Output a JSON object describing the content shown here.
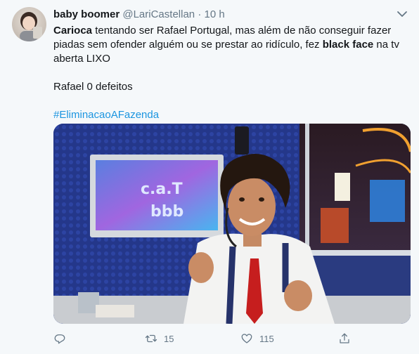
{
  "tweet": {
    "display_name": "baby boomer",
    "handle": "@LariCastellan",
    "separator": "·",
    "time": "10 h",
    "text": {
      "l1_bold": "Carioca",
      "l1_rest": " tentando ser Rafael Portugal, mas além de não conseguir fazer",
      "l2_a": "piadas sem ofender alguém ou se prestar ao ridículo, fez ",
      "l2_bold": "black face",
      "l2_b": " na tv",
      "l3": "aberta LIXO",
      "l4": "Rafael 0 defeitos",
      "hashtag": "#EliminacaoAFazenda"
    },
    "media": {
      "screen_logo_line1": "c.a.T",
      "screen_logo_line2": "bbb"
    },
    "actions": {
      "reply_count": "",
      "retweet_count": "15",
      "like_count": "115"
    }
  },
  "colors": {
    "link": "#1b95e0",
    "secondary": "#657786",
    "background": "#f5f8fa"
  },
  "icons": [
    "chevron-down-icon",
    "reply-icon",
    "retweet-icon",
    "like-icon",
    "share-icon"
  ]
}
